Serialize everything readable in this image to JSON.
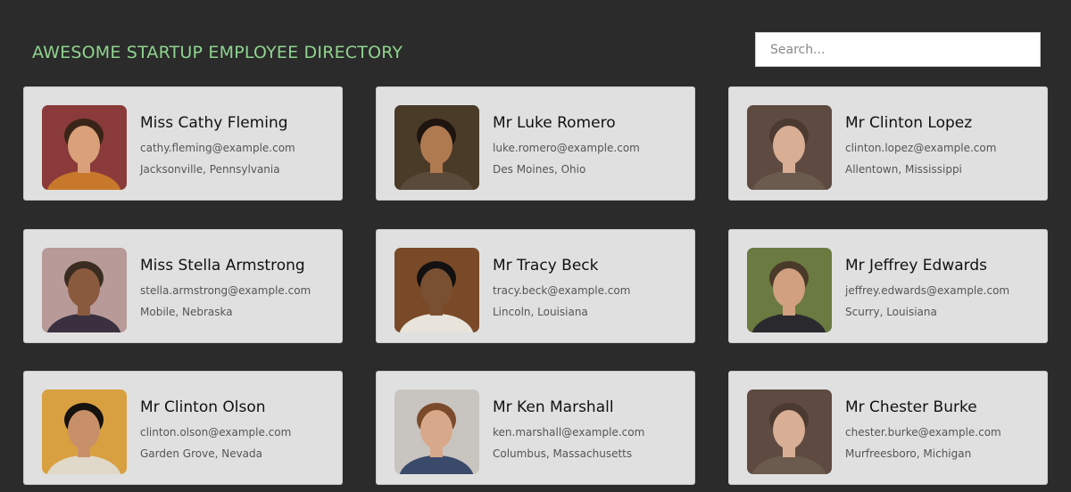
{
  "header": {
    "title": "AWESOME STARTUP EMPLOYEE DIRECTORY"
  },
  "search": {
    "placeholder": "Search..."
  },
  "employees": [
    {
      "name": "Miss Cathy Fleming",
      "email": "cathy.fleming@example.com",
      "location": "Jacksonville, Pennsylvania",
      "photo_bg": "#8a3a3a",
      "photo_skin": "#d9a07a",
      "photo_hair": "#3a2418",
      "photo_shirt": "#c8782a"
    },
    {
      "name": "Mr Luke Romero",
      "email": "luke.romero@example.com",
      "location": "Des Moines, Ohio",
      "photo_bg": "#4a3a28",
      "photo_skin": "#b07a50",
      "photo_hair": "#1e1510",
      "photo_shirt": "#5a4a3a"
    },
    {
      "name": "Mr Clinton Lopez",
      "email": "clinton.lopez@example.com",
      "location": "Allentown, Mississippi",
      "photo_bg": "#5e4a40",
      "photo_skin": "#d8ae94",
      "photo_hair": "#4a3a30",
      "photo_shirt": "#6b5b4e"
    },
    {
      "name": "Miss Stella Armstrong",
      "email": "stella.armstrong@example.com",
      "location": "Mobile, Nebraska",
      "photo_bg": "#b89a98",
      "photo_skin": "#8a5a3e",
      "photo_hair": "#3a2c20",
      "photo_shirt": "#3a3040"
    },
    {
      "name": "Mr Tracy Beck",
      "email": "tracy.beck@example.com",
      "location": "Lincoln, Louisiana",
      "photo_bg": "#7a4a28",
      "photo_skin": "#7a5032",
      "photo_hair": "#121010",
      "photo_shirt": "#e8e4dc"
    },
    {
      "name": "Mr Jeffrey Edwards",
      "email": "jeffrey.edwards@example.com",
      "location": "Scurry, Louisiana",
      "photo_bg": "#6a7a40",
      "photo_skin": "#d0a080",
      "photo_hair": "#4a3a2a",
      "photo_shirt": "#2a2a2e"
    },
    {
      "name": "Mr Clinton Olson",
      "email": "clinton.olson@example.com",
      "location": "Garden Grove, Nevada",
      "photo_bg": "#d8a040",
      "photo_skin": "#c89068",
      "photo_hair": "#151210",
      "photo_shirt": "#e0d8c8"
    },
    {
      "name": "Mr Ken Marshall",
      "email": "ken.marshall@example.com",
      "location": "Columbus, Massachusetts",
      "photo_bg": "#c8c4c0",
      "photo_skin": "#d8a88a",
      "photo_hair": "#7a4a2a",
      "photo_shirt": "#3a4a6a"
    },
    {
      "name": "Mr Chester Burke",
      "email": "chester.burke@example.com",
      "location": "Murfreesboro, Michigan",
      "photo_bg": "#5e4a40",
      "photo_skin": "#d8ae94",
      "photo_hair": "#4a3a30",
      "photo_shirt": "#6b5b4e"
    }
  ]
}
